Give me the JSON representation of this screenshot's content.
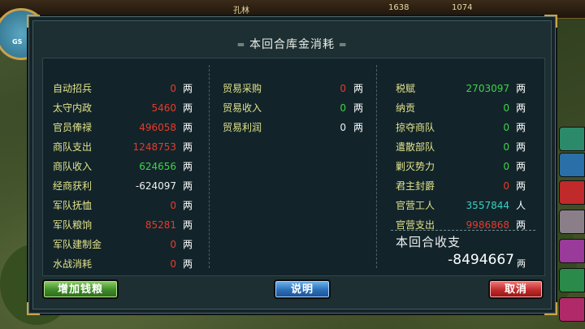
{
  "topbar": {
    "name": "孔林",
    "value1": "1638",
    "value2": "1074"
  },
  "minimap": {
    "label": "GS"
  },
  "dialog": {
    "title": "本回合库金消耗",
    "columns": [
      {
        "rows": [
          {
            "label": "自动招兵",
            "value": "0",
            "color": "red",
            "unit": "两"
          },
          {
            "label": "太守内政",
            "value": "5460",
            "color": "red",
            "unit": "两"
          },
          {
            "label": "官员俸禄",
            "value": "496058",
            "color": "red",
            "unit": "两"
          },
          {
            "label": "商队支出",
            "value": "1248753",
            "color": "red",
            "unit": "两"
          },
          {
            "label": "商队收入",
            "value": "624656",
            "color": "green",
            "unit": "两"
          },
          {
            "label": "经商获利",
            "value": "-624097",
            "color": "white",
            "unit": "两"
          },
          {
            "label": "军队抚恤",
            "value": "0",
            "color": "red",
            "unit": "两"
          },
          {
            "label": "军队粮饷",
            "value": "85281",
            "color": "red",
            "unit": "两"
          },
          {
            "label": "军队建制金",
            "value": "0",
            "color": "red",
            "unit": "两"
          },
          {
            "label": "水战消耗",
            "value": "0",
            "color": "red",
            "unit": "两"
          }
        ]
      },
      {
        "rows": [
          {
            "label": "贸易采购",
            "value": "0",
            "color": "red",
            "unit": "两"
          },
          {
            "label": "贸易收入",
            "value": "0",
            "color": "green",
            "unit": "两"
          },
          {
            "label": "贸易利润",
            "value": "0",
            "color": "white",
            "unit": "两"
          }
        ]
      },
      {
        "rows": [
          {
            "label": "税赋",
            "value": "2703097",
            "color": "green",
            "unit": "两"
          },
          {
            "label": "纳贡",
            "value": "0",
            "color": "green",
            "unit": "两"
          },
          {
            "label": "掠夺商队",
            "value": "0",
            "color": "green",
            "unit": "两"
          },
          {
            "label": "遣散部队",
            "value": "0",
            "color": "green",
            "unit": "两"
          },
          {
            "label": "剿灭势力",
            "value": "0",
            "color": "green",
            "unit": "两"
          },
          {
            "label": "君主封爵",
            "value": "0",
            "color": "red",
            "unit": "两"
          },
          {
            "label": "官营工人",
            "value": "3557844",
            "color": "cyan",
            "unit": "人"
          },
          {
            "label": "官营支出",
            "value": "9986868",
            "color": "red",
            "unit": "两"
          }
        ]
      }
    ],
    "summary": {
      "label": "本回合收支",
      "value": "-8494667",
      "unit": "两"
    },
    "buttons": {
      "add": "增加钱粮",
      "explain": "说明",
      "cancel": "取消"
    }
  },
  "colors": {
    "red": "#e83a2a",
    "green": "#3fd24a",
    "white": "#f0f0f0",
    "cyan": "#39d0c0"
  }
}
